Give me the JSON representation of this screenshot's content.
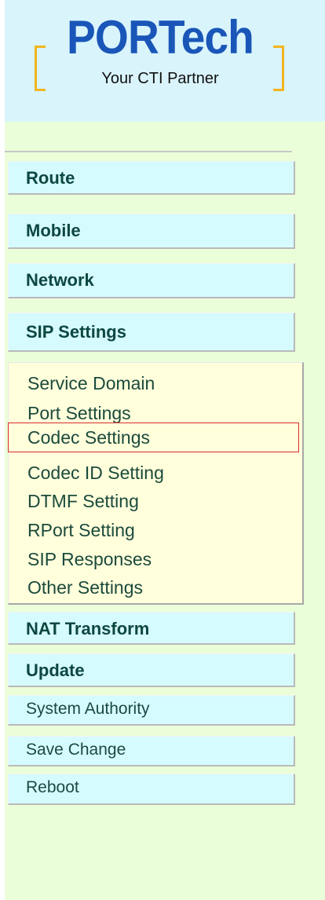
{
  "logo": {
    "brand": "PORTech",
    "tagline": "Your CTI Partner"
  },
  "menu": {
    "route": "Route",
    "mobile": "Mobile",
    "network": "Network",
    "sip_settings": "SIP Settings",
    "nat_transform": "NAT Transform",
    "update": "Update",
    "system_authority": "System Authority",
    "save_change": "Save Change",
    "reboot": "Reboot"
  },
  "sip_submenu": {
    "items": [
      "Service Domain",
      "Port Settings",
      "Codec Settings",
      "Codec ID Setting",
      "DTMF Setting",
      "RPort Setting",
      "SIP Responses",
      "Other Settings"
    ],
    "selected": "Codec Settings"
  },
  "colors": {
    "panel_background": "#eaffd9",
    "logo_band": "#d9f4fb",
    "menu_button": "#d5fbff",
    "submenu_background": "#ffffdc",
    "selection_outline": "#d82b2b",
    "brand_blue": "#1a56b8",
    "bracket_gold": "#f2b51f"
  }
}
